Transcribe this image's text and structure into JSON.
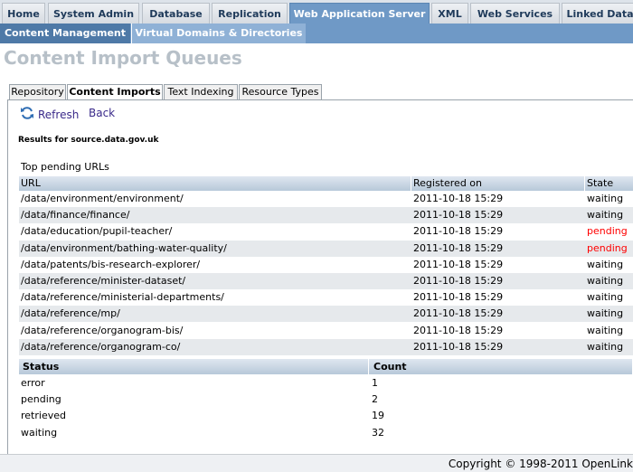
{
  "nav": {
    "main_tabs": [
      "Home",
      "System Admin",
      "Database",
      "Replication",
      "Web Application Server",
      "XML",
      "Web Services",
      "Linked Data"
    ],
    "active_main": "Web Application Server",
    "sub_tabs": [
      "Content Management",
      "Virtual Domains & Directories"
    ],
    "active_sub": "Content Management"
  },
  "page": {
    "title": "Content Import Queues"
  },
  "subtabs": [
    "Repository",
    "Content Imports",
    "Text Indexing",
    "Resource Types"
  ],
  "active_subtab": "Content Imports",
  "toolbar": {
    "refresh_label": "Refresh",
    "back_label": "Back",
    "refresh_icon": "refresh-icon"
  },
  "results_label": "Results for source.data.gov.uk",
  "pending": {
    "caption": "Top pending URLs",
    "columns": [
      "URL",
      "Registered on",
      "State"
    ],
    "rows": [
      {
        "url": "/data/environment/environment/",
        "registered": "2011-10-18 15:29",
        "state": "waiting"
      },
      {
        "url": "/data/finance/finance/",
        "registered": "2011-10-18 15:29",
        "state": "waiting"
      },
      {
        "url": "/data/education/pupil-teacher/",
        "registered": "2011-10-18 15:29",
        "state": "pending"
      },
      {
        "url": "/data/environment/bathing-water-quality/",
        "registered": "2011-10-18 15:29",
        "state": "pending"
      },
      {
        "url": "/data/patents/bis-research-explorer/",
        "registered": "2011-10-18 15:29",
        "state": "waiting"
      },
      {
        "url": "/data/reference/minister-dataset/",
        "registered": "2011-10-18 15:29",
        "state": "waiting"
      },
      {
        "url": "/data/reference/ministerial-departments/",
        "registered": "2011-10-18 15:29",
        "state": "waiting"
      },
      {
        "url": "/data/reference/mp/",
        "registered": "2011-10-18 15:29",
        "state": "waiting"
      },
      {
        "url": "/data/reference/organogram-bis/",
        "registered": "2011-10-18 15:29",
        "state": "waiting"
      },
      {
        "url": "/data/reference/organogram-co/",
        "registered": "2011-10-18 15:29",
        "state": "waiting"
      }
    ]
  },
  "status": {
    "columns": [
      "Status",
      "Count"
    ],
    "rows": [
      {
        "status": "error",
        "count": "1"
      },
      {
        "status": "pending",
        "count": "2"
      },
      {
        "status": "retrieved",
        "count": "19"
      },
      {
        "status": "waiting",
        "count": "32"
      }
    ]
  },
  "footer": {
    "text": "Copyright © 1998-2011 OpenLink"
  },
  "colors": {
    "accent": "#6f99c6",
    "pending": "#ff0000",
    "title": "#b7c0c8"
  }
}
